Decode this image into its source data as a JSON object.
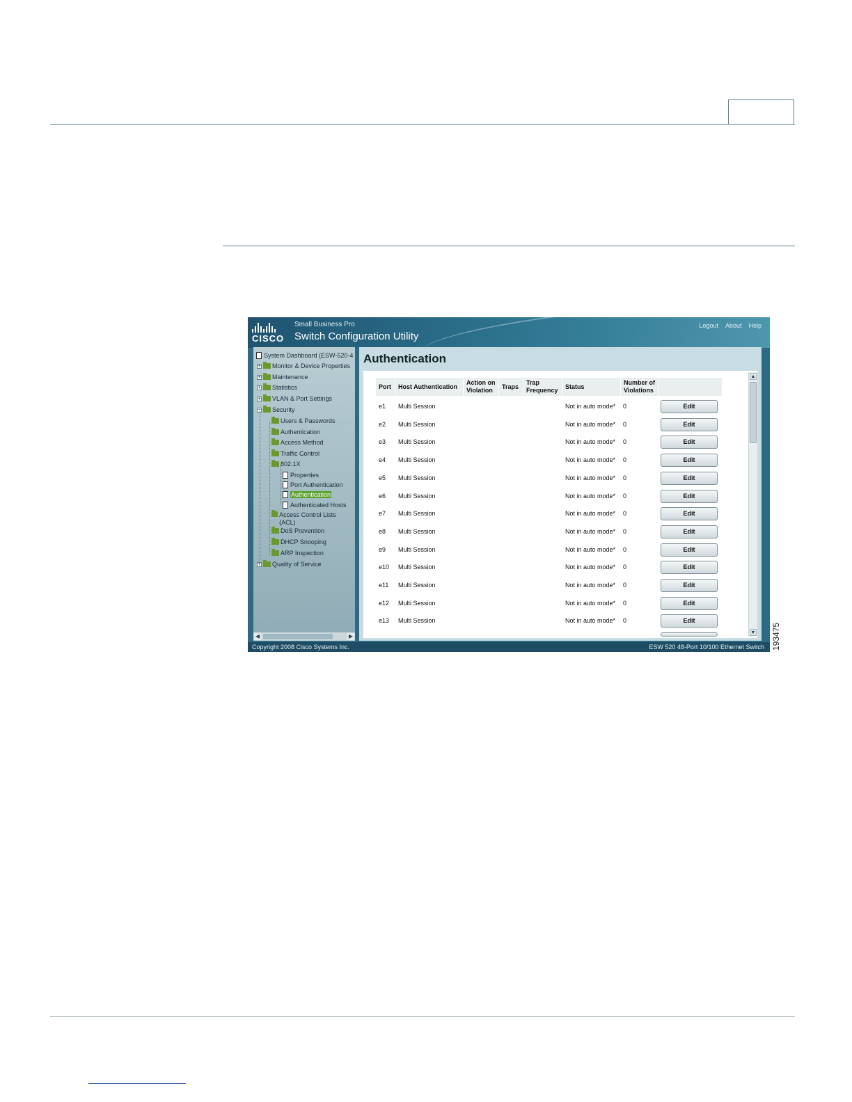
{
  "figure_id": "193475",
  "app": {
    "brand_sub": "Small Business Pro",
    "brand_title": "Switch Configuration Utility",
    "logo_text": "CISCO",
    "top_links": [
      "Logout",
      "About",
      "Help"
    ]
  },
  "sidebar": {
    "items": [
      {
        "label": "System Dashboard (ESW-520-4",
        "icon": "page-icon",
        "level": 0,
        "expander": ""
      },
      {
        "label": "Monitor & Device Properties",
        "icon": "folder-icon",
        "level": 0,
        "expander": "+"
      },
      {
        "label": "Maintenance",
        "icon": "folder-icon",
        "level": 0,
        "expander": "+"
      },
      {
        "label": "Statistics",
        "icon": "folder-icon",
        "level": 0,
        "expander": "+"
      },
      {
        "label": "VLAN & Port Settings",
        "icon": "folder-icon",
        "level": 0,
        "expander": "+"
      },
      {
        "label": "Security",
        "icon": "folder-open-icon",
        "level": 0,
        "expander": "-"
      },
      {
        "label": "Users & Passwords",
        "icon": "folder-icon",
        "level": 1,
        "expander": ""
      },
      {
        "label": "Authentication",
        "icon": "folder-icon",
        "level": 1,
        "expander": ""
      },
      {
        "label": "Access Method",
        "icon": "folder-icon",
        "level": 1,
        "expander": ""
      },
      {
        "label": "Traffic Control",
        "icon": "folder-icon",
        "level": 1,
        "expander": ""
      },
      {
        "label": "802.1X",
        "icon": "folder-open-icon",
        "level": 1,
        "expander": ""
      },
      {
        "label": "Properties",
        "icon": "page-icon",
        "level": 2,
        "expander": ""
      },
      {
        "label": "Port Authentication",
        "icon": "page-icon",
        "level": 2,
        "expander": ""
      },
      {
        "label": "Authentication",
        "icon": "page-icon",
        "level": 2,
        "expander": "",
        "selected": true
      },
      {
        "label": "Authenticated Hosts",
        "icon": "page-icon",
        "level": 2,
        "expander": ""
      },
      {
        "label": "Access Control Lists (ACL)",
        "icon": "folder-icon",
        "level": 1,
        "expander": ""
      },
      {
        "label": "DoS Prevention",
        "icon": "folder-icon",
        "level": 1,
        "expander": ""
      },
      {
        "label": "DHCP Snooping",
        "icon": "folder-icon",
        "level": 1,
        "expander": ""
      },
      {
        "label": "ARP Inspection",
        "icon": "folder-icon",
        "level": 1,
        "expander": ""
      },
      {
        "label": "Quality of Service",
        "icon": "folder-icon",
        "level": 0,
        "expander": "+"
      }
    ]
  },
  "main": {
    "title": "Authentication",
    "columns": [
      "Port",
      "Host Authentication",
      "Action on Violation",
      "Traps",
      "Trap Frequency",
      "Status",
      "Number of Violations",
      ""
    ],
    "edit_label": "Edit",
    "rows": [
      {
        "port": "e1",
        "host_auth": "Multi Session",
        "status": "Not in auto mode*",
        "violations": "0"
      },
      {
        "port": "e2",
        "host_auth": "Multi Session",
        "status": "Not in auto mode*",
        "violations": "0"
      },
      {
        "port": "e3",
        "host_auth": "Multi Session",
        "status": "Not in auto mode*",
        "violations": "0"
      },
      {
        "port": "e4",
        "host_auth": "Multi Session",
        "status": "Not in auto mode*",
        "violations": "0"
      },
      {
        "port": "e5",
        "host_auth": "Multi Session",
        "status": "Not in auto mode*",
        "violations": "0"
      },
      {
        "port": "e6",
        "host_auth": "Multi Session",
        "status": "Not in auto mode*",
        "violations": "0"
      },
      {
        "port": "e7",
        "host_auth": "Multi Session",
        "status": "Not in auto mode*",
        "violations": "0"
      },
      {
        "port": "e8",
        "host_auth": "Multi Session",
        "status": "Not in auto mode*",
        "violations": "0"
      },
      {
        "port": "e9",
        "host_auth": "Multi Session",
        "status": "Not in auto mode*",
        "violations": "0"
      },
      {
        "port": "e10",
        "host_auth": "Multi Session",
        "status": "Not in auto mode*",
        "violations": "0"
      },
      {
        "port": "e11",
        "host_auth": "Multi Session",
        "status": "Not in auto mode*",
        "violations": "0"
      },
      {
        "port": "e12",
        "host_auth": "Multi Session",
        "status": "Not in auto mode*",
        "violations": "0"
      },
      {
        "port": "e13",
        "host_auth": "Multi Session",
        "status": "Not in auto mode*",
        "violations": "0"
      }
    ]
  },
  "footer": {
    "copyright": "Copyright 2008 Cisco Systems Inc.",
    "device": "ESW 520 48-Port 10/100 Ethernet Switch"
  },
  "colors": {
    "header": "#2f7792",
    "selected": "#5aa12b",
    "content_bg": "#c8dde3"
  }
}
